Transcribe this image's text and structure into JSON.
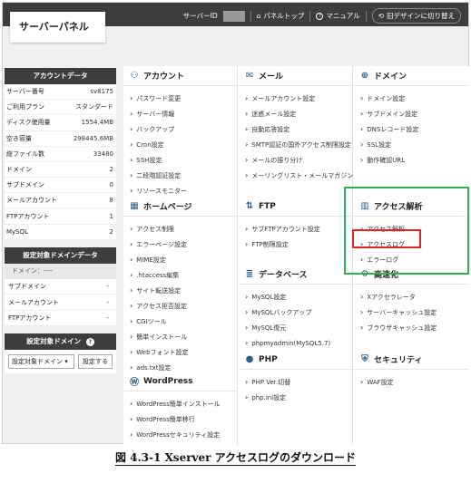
{
  "header": {
    "logo": "サーバーパネル",
    "server_id_label": "サーバーID",
    "panel_top": "パネルトップ",
    "manual": "マニュアル",
    "old_design": "旧デザインに切り替え"
  },
  "account": {
    "title": "アカウントデータ",
    "rows": [
      {
        "label": "サーバー番号",
        "value": "sv8175"
      },
      {
        "label": "ご利用プラン",
        "value": "スタンダード"
      },
      {
        "label": "ディスク使用量",
        "value": "1554.4MB"
      },
      {
        "label": "空き容量",
        "value": "298445.6MB"
      },
      {
        "label": "総ファイル数",
        "value": "33480"
      },
      {
        "label": "ドメイン",
        "value": "2"
      },
      {
        "label": "サブドメイン",
        "value": "0"
      },
      {
        "label": "メールアカウント",
        "value": "8"
      },
      {
        "label": "FTPアカウント",
        "value": "1"
      },
      {
        "label": "MySQL",
        "value": "2"
      }
    ]
  },
  "domain_data": {
    "title": "設定対象ドメインデータ",
    "domain_line": "ドメイン：----",
    "rows": [
      {
        "label": "サブドメイン",
        "value": "-"
      },
      {
        "label": "メールアカウント",
        "value": "-"
      },
      {
        "label": "FTPアカウント",
        "value": "-"
      }
    ]
  },
  "domain_select": {
    "title": "設定対象ドメイン",
    "select_value": "設定対象ドメイン",
    "button": "設定する"
  },
  "sections": {
    "account": {
      "title": "アカウント",
      "items": [
        "パスワード変更",
        "サーバー情報",
        "バックアップ",
        "Cron設定",
        "SSH設定",
        "二段階認証設定",
        "リソースモニター"
      ]
    },
    "mail": {
      "title": "メール",
      "items": [
        "メールアカウント設定",
        "迷惑メール設定",
        "自動応答設定",
        "SMTP認証の国外アクセス制限設定",
        "メールの振り分け",
        "メーリングリスト・メールマガジン"
      ]
    },
    "domain": {
      "title": "ドメイン",
      "items": [
        "ドメイン設定",
        "サブドメイン設定",
        "DNSレコード設定",
        "SSL設定",
        "動作確認URL"
      ]
    },
    "homepage": {
      "title": "ホームページ",
      "items": [
        "アクセス制限",
        "エラーページ設定",
        "MIME設定",
        ".htaccess編集",
        "サイト転送設定",
        "アクセス拒否設定",
        "CGIツール",
        "簡単インストール",
        "Webフォント設定",
        "ads.txt設定"
      ]
    },
    "ftp": {
      "title": "FTP",
      "items": [
        "サブFTPアカウント設定",
        "FTP制限設定"
      ]
    },
    "analytics": {
      "title": "アクセス解析",
      "items": [
        "アクセス解析",
        "アクセスログ",
        "エラーログ"
      ]
    },
    "database": {
      "title": "データベース",
      "items": [
        "MySQL設定",
        "MySQLバックアップ",
        "MySQL復元",
        "phpmyadmin(MySQL5.7)"
      ]
    },
    "speedup": {
      "title": "高速化",
      "items": [
        "Xアクセラレータ",
        "サーバーキャッシュ設定",
        "ブラウザキャッシュ設定"
      ]
    },
    "wordpress": {
      "title": "WordPress",
      "items": [
        "WordPress簡単インストール",
        "WordPress簡単移行",
        "WordPressセキュリティ設定"
      ]
    },
    "php": {
      "title": "PHP",
      "items": [
        "PHP Ver.切替",
        "php.ini設定"
      ]
    },
    "security": {
      "title": "セキュリティ",
      "items": [
        "WAF設定"
      ]
    }
  },
  "caption": "図 4.3-1 Xserver アクセスログのダウンロード",
  "colors": {
    "highlight_green": "#2fb24f",
    "highlight_red": "#e02424",
    "header_bg": "#3d3d3d"
  }
}
